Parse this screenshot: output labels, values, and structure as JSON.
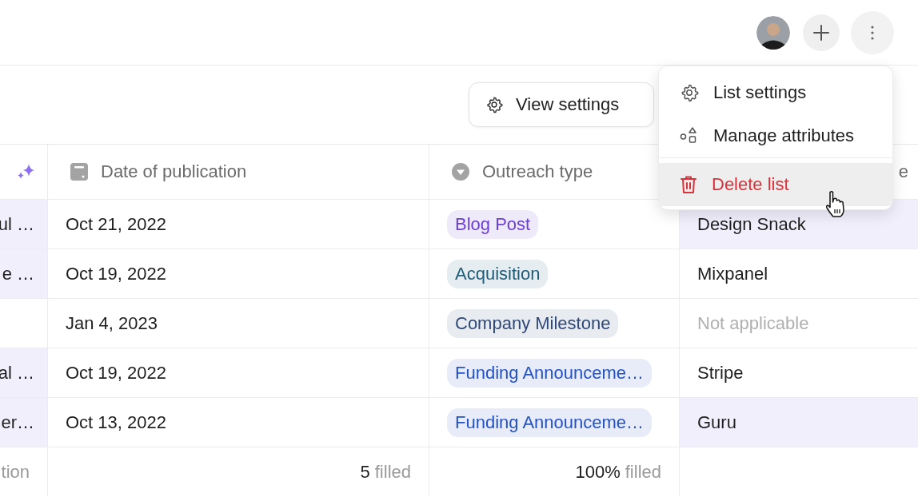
{
  "top_bar": {
    "buttons": [
      {
        "kind": "add"
      },
      {
        "kind": "more",
        "pressed": true
      }
    ]
  },
  "toolbar": {
    "view_settings": "View settings"
  },
  "table": {
    "columns": [
      {
        "kind": "ai"
      },
      {
        "label": "Date of publication",
        "kind": "date"
      },
      {
        "label": "Outreach type",
        "kind": "select"
      },
      {
        "label": "e",
        "kind": "text"
      }
    ],
    "rows": [
      {
        "column_1": {
          "text": "ul …",
          "highlighted": true
        },
        "date": "Oct 21, 2022",
        "outreach": {
          "text": "Blog Post",
          "color": "#6b3fd4"
        },
        "column_4": {
          "text": "Design Snack",
          "empty": false,
          "highlighted": true
        }
      },
      {
        "column_1": {
          "text": "e …",
          "highlighted": true
        },
        "date": "Oct 19, 2022",
        "outreach": {
          "text": "Acquisition",
          "color": "#1f5b78"
        },
        "column_4": {
          "text": "Mixpanel",
          "empty": false,
          "highlighted": false
        }
      },
      {
        "column_1": {
          "highlighted": false
        },
        "date": "Jan 4, 2023",
        "outreach": {
          "text": "Company Milestone",
          "color": "#2e4878"
        },
        "column_4": {
          "text": "Not applicable",
          "empty": true,
          "highlighted": false
        }
      },
      {
        "column_1": {
          "text": "al …",
          "highlighted": true
        },
        "date": "Oct 19, 2022",
        "outreach": {
          "text": "Funding Announceme…",
          "color": "#2452c2"
        },
        "column_4": {
          "text": "Stripe",
          "empty": false,
          "highlighted": false
        }
      },
      {
        "column_1": {
          "text": "er…",
          "highlighted": true
        },
        "date": "Oct 13, 2022",
        "outreach": {
          "text": "Funding Announceme…",
          "color": "#2452c2"
        },
        "column_4": {
          "text": "Guru",
          "empty": false,
          "highlighted": true
        }
      }
    ],
    "footer": [
      {
        "label": "tion"
      },
      {
        "count": "5",
        "label": "filled"
      },
      {
        "count": "100%",
        "label": "filled"
      }
    ]
  },
  "menu": {
    "items": [
      {
        "label": "List settings",
        "kind": "settings",
        "hovered": false
      },
      {
        "label": "Manage attributes",
        "kind": "attributes",
        "hovered": false
      },
      {
        "label": "Delete list",
        "kind": "delete",
        "hovered": true
      }
    ]
  }
}
